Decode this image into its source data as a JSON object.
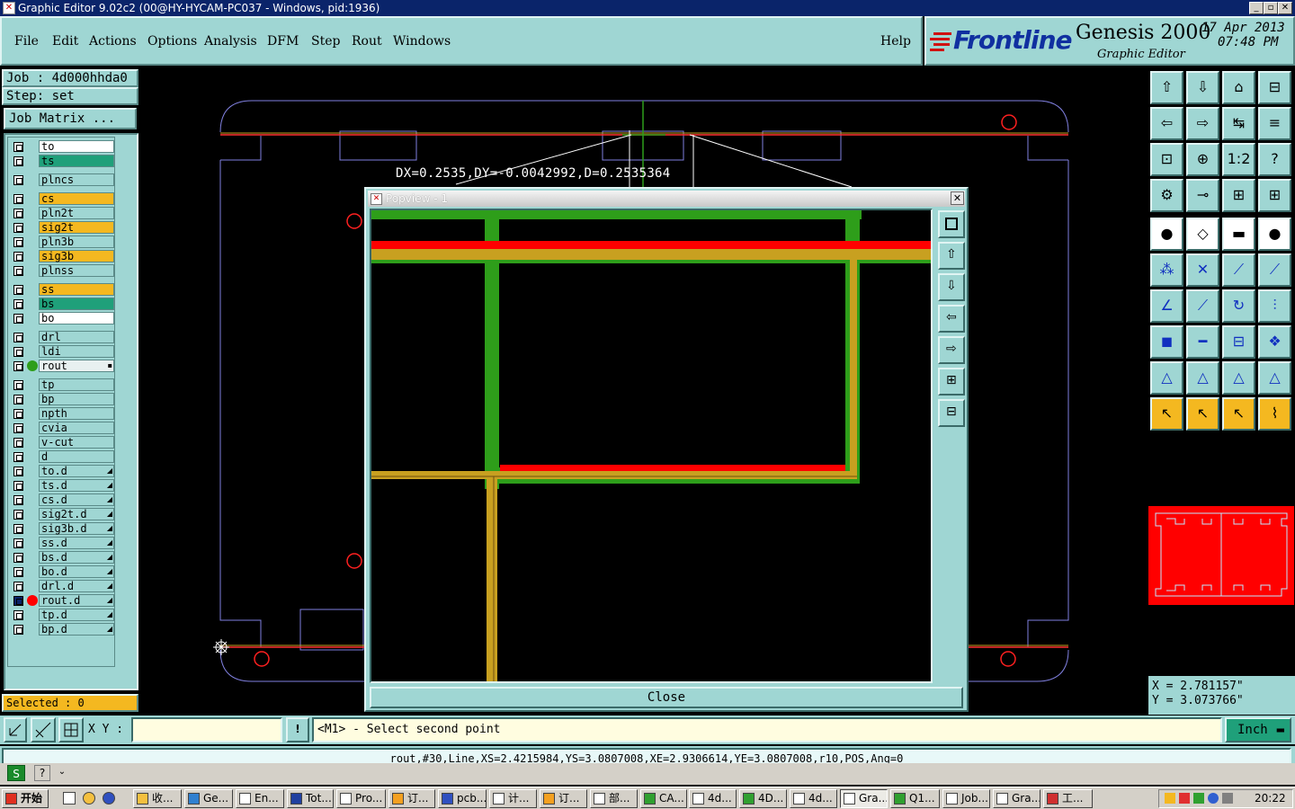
{
  "window": {
    "title": "Graphic Editor 9.02c2 (00@HY-HYCAM-PC037 - Windows, pid:1936)"
  },
  "menu": {
    "items": [
      "File",
      "Edit",
      "Actions",
      "Options",
      "Analysis",
      "DFM",
      "Step",
      "Rout",
      "Windows"
    ],
    "help": "Help"
  },
  "brand": {
    "logo": "Frontline",
    "product": "Genesis 2000",
    "subtitle": "Graphic Editor",
    "date": "17 Apr 2013",
    "time": "07:48 PM"
  },
  "job": {
    "job_label": "Job : 4d000hhda0",
    "step_label": "Step: set",
    "matrix_button": "Job Matrix ..."
  },
  "layers": [
    {
      "name": "to",
      "color": "#ffffff"
    },
    {
      "name": "ts",
      "color": "#1fa07a"
    },
    {
      "name": "plncs",
      "color": "#9fd6d3"
    },
    {
      "name": "cs",
      "color": "#f4b820"
    },
    {
      "name": "pln2t",
      "color": "#9fd6d3"
    },
    {
      "name": "sig2t",
      "color": "#f4b820"
    },
    {
      "name": "pln3b",
      "color": "#9fd6d3"
    },
    {
      "name": "sig3b",
      "color": "#f4b820"
    },
    {
      "name": "plnss",
      "color": "#9fd6d3"
    },
    {
      "name": "ss",
      "color": "#f4b820"
    },
    {
      "name": "bs",
      "color": "#1fa07a"
    },
    {
      "name": "bo",
      "color": "#ffffff"
    },
    {
      "name": "drl",
      "color": "#9fd6d3"
    },
    {
      "name": "ldi",
      "color": "#9fd6d3"
    },
    {
      "name": "rout",
      "color": "#e8f0f0"
    },
    {
      "name": "tp",
      "color": "#9fd6d3"
    },
    {
      "name": "bp",
      "color": "#9fd6d3"
    },
    {
      "name": "npth",
      "color": "#9fd6d3"
    },
    {
      "name": "cvia",
      "color": "#9fd6d3"
    },
    {
      "name": "v-cut",
      "color": "#9fd6d3"
    },
    {
      "name": "d",
      "color": "#9fd6d3"
    },
    {
      "name": "to.d",
      "color": "#9fd6d3"
    },
    {
      "name": "ts.d",
      "color": "#9fd6d3"
    },
    {
      "name": "cs.d",
      "color": "#9fd6d3"
    },
    {
      "name": "sig2t.d",
      "color": "#9fd6d3"
    },
    {
      "name": "sig3b.d",
      "color": "#9fd6d3"
    },
    {
      "name": "ss.d",
      "color": "#9fd6d3"
    },
    {
      "name": "bs.d",
      "color": "#9fd6d3"
    },
    {
      "name": "bo.d",
      "color": "#9fd6d3"
    },
    {
      "name": "drl.d",
      "color": "#9fd6d3"
    },
    {
      "name": "rout.d",
      "color": "#9fd6d3"
    },
    {
      "name": "tp.d",
      "color": "#9fd6d3"
    },
    {
      "name": "bp.d",
      "color": "#9fd6d3"
    }
  ],
  "selected": {
    "label": "Selected : 0"
  },
  "canvas": {
    "measure": "DX=0.2535,DY=-0.0042992,D=0.2535364"
  },
  "popup": {
    "title": "Popview - 1",
    "close_label": "Close"
  },
  "coords": {
    "x": "X = 2.781157\"",
    "y": "Y = 3.073766\""
  },
  "command": {
    "xy_label": "X Y :",
    "xy_value": "",
    "prompt": "<M1> - Select second point",
    "unit": "Inch"
  },
  "status": {
    "text": "rout,#30,Line,XS=2.4215984,YS=3.0807008,XE=2.9306614,YE=3.0807008,r10,POS,Ang=0"
  },
  "taskbar": {
    "start": "开始",
    "clock": "20:22",
    "tasks": [
      "收...",
      "Ge...",
      "En...",
      "Tot...",
      "Pro...",
      "订...",
      "pcb...",
      "计...",
      "订...",
      "部...",
      "CA...",
      "4d...",
      "4D...",
      "4d...",
      "Gra...",
      "Q1...",
      "Job...",
      "Gra...",
      "工..."
    ]
  },
  "colors": {
    "panel": "#9fd6d3",
    "accent_red": "#ff0000",
    "accent_orange": "#f4b820",
    "green": "#2e9e1a"
  }
}
